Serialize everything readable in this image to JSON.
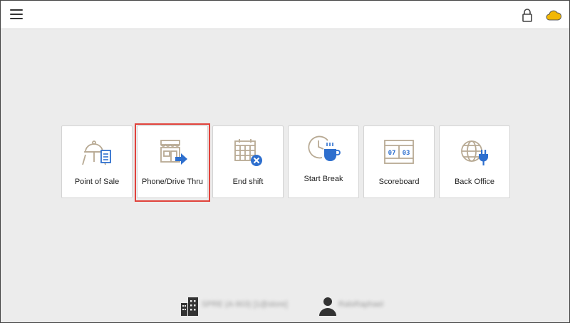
{
  "header": {
    "menu_icon": "hamburger-menu-icon",
    "lock_icon": "lock-icon",
    "cloud_icon": "cloud-icon",
    "cloud_color": "#f2b705"
  },
  "tiles": [
    {
      "label": "Point of Sale",
      "icon": "point-of-sale-icon"
    },
    {
      "label": "Phone/Drive Thru",
      "icon": "phone-drive-thru-icon",
      "highlighted": true
    },
    {
      "label": "End shift",
      "icon": "end-shift-icon"
    },
    {
      "label": "Start Break",
      "icon": "start-break-icon"
    },
    {
      "label": "Scoreboard",
      "icon": "scoreboard-icon",
      "digits": [
        "07",
        "03"
      ]
    },
    {
      "label": "Back Office",
      "icon": "back-office-icon"
    }
  ],
  "footer": {
    "store_label": "SPRE (A-903) [1@store]",
    "user_label": "RalsRaphael"
  },
  "colors": {
    "accent_blue": "#2e6fce",
    "icon_tan": "#b8aa94",
    "highlight_red": "#e0423b"
  }
}
